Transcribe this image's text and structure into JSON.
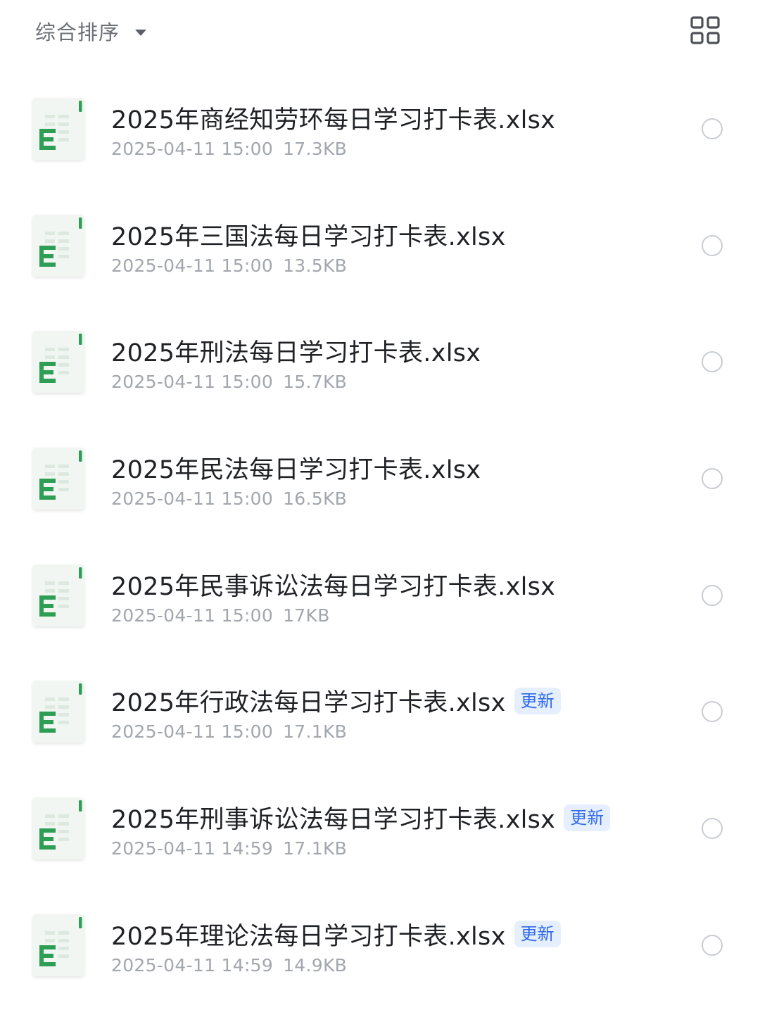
{
  "toolbar": {
    "sort_label": "综合排序",
    "sort_icon": "caret-down-icon",
    "view_toggle_icon": "grid-view-icon"
  },
  "colors": {
    "spreadsheet_green": "#2e9e55",
    "badge_bg": "#e6efff",
    "badge_text": "#2f6ae8",
    "meta_gray": "#a2a6ad"
  },
  "files": [
    {
      "name": "2025年商经知劳环每日学习打卡表.xlsx",
      "date": "2025-04-11 15:00",
      "size": "17.3KB",
      "badge": ""
    },
    {
      "name": "2025年三国法每日学习打卡表.xlsx",
      "date": "2025-04-11 15:00",
      "size": "13.5KB",
      "badge": ""
    },
    {
      "name": "2025年刑法每日学习打卡表.xlsx",
      "date": "2025-04-11 15:00",
      "size": "15.7KB",
      "badge": ""
    },
    {
      "name": "2025年民法每日学习打卡表.xlsx",
      "date": "2025-04-11 15:00",
      "size": "16.5KB",
      "badge": ""
    },
    {
      "name": "2025年民事诉讼法每日学习打卡表.xlsx",
      "date": "2025-04-11 15:00",
      "size": "17KB",
      "badge": ""
    },
    {
      "name": "2025年行政法每日学习打卡表.xlsx",
      "date": "2025-04-11 15:00",
      "size": "17.1KB",
      "badge": "更新"
    },
    {
      "name": "2025年刑事诉讼法每日学习打卡表.xlsx",
      "date": "2025-04-11 14:59",
      "size": "17.1KB",
      "badge": "更新"
    },
    {
      "name": "2025年理论法每日学习打卡表.xlsx",
      "date": "2025-04-11 14:59",
      "size": "14.9KB",
      "badge": "更新"
    }
  ]
}
